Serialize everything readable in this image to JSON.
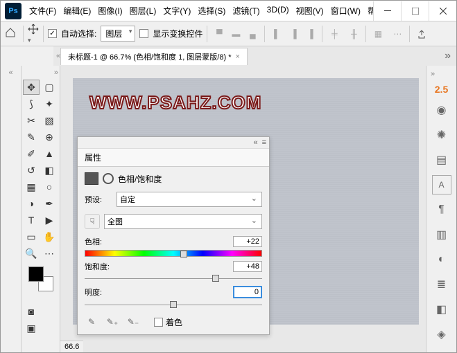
{
  "menu": [
    "文件(F)",
    "编辑(E)",
    "图像(I)",
    "图层(L)",
    "文字(Y)",
    "选择(S)",
    "滤镜(T)",
    "3D(D)",
    "视图(V)",
    "窗口(W)",
    "帮"
  ],
  "options": {
    "auto_select": "自动选择:",
    "layer_dd": "图层",
    "show_transform": "显示变换控件"
  },
  "doc_tab": "未标题-1 @ 66.7% (色相/饱和度 1, 图层蒙版/8) *",
  "watermark": "WWW.PSAHZ.COM",
  "zoom_status": "66.6",
  "right_label": "2.5",
  "panel": {
    "title": "属性",
    "adj_name": "色相/饱和度",
    "preset_label": "预设:",
    "preset_value": "自定",
    "range_value": "全图",
    "hue_label": "色相:",
    "hue_value": "+22",
    "sat_label": "饱和度:",
    "sat_value": "+48",
    "light_label": "明度:",
    "light_value": "0",
    "colorize": "着色"
  }
}
